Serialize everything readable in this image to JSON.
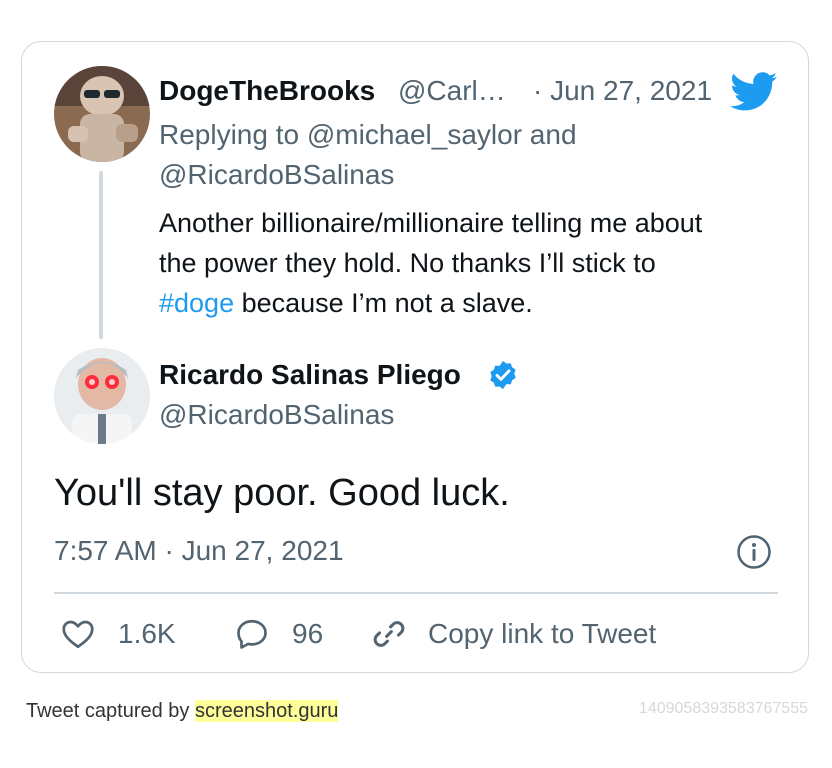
{
  "reply_tweet": {
    "author_name": "DogeTheBrooks",
    "handle_truncated": "@Carl…",
    "date": "· Jun 27, 2021",
    "replying_line1": "Replying to @michael_saylor and",
    "replying_line2": "@RicardoBSalinas",
    "text_line1": "Another billionaire/millionaire telling me about",
    "text_line2": "the power they hold. No thanks I’ll stick to",
    "hashtag": "#doge",
    "text_line3_rest": " because I’m not a slave.",
    "logo_icon": "twitter-bird-icon",
    "logo_color": "#1d9bf0"
  },
  "main_tweet": {
    "author_name": "Ricardo Salinas Pliego",
    "handle": "@RicardoBSalinas",
    "verified_icon": "verified-badge-icon",
    "text": "You'll stay poor. Good luck.",
    "timestamp": "7:57 AM · Jun 27, 2021",
    "info_icon": "info-icon"
  },
  "actions": {
    "likes": "1.6K",
    "replies": "96",
    "copy_link": "Copy link to Tweet"
  },
  "footer": {
    "captured_by": "Tweet captured by ",
    "site": "screenshot.guru",
    "tweet_id": "1409058393583767555"
  },
  "colors": {
    "accent": "#1d9bf0",
    "muted_text": "#536471",
    "border": "#cfd9de",
    "highlight": "#ffff99"
  }
}
